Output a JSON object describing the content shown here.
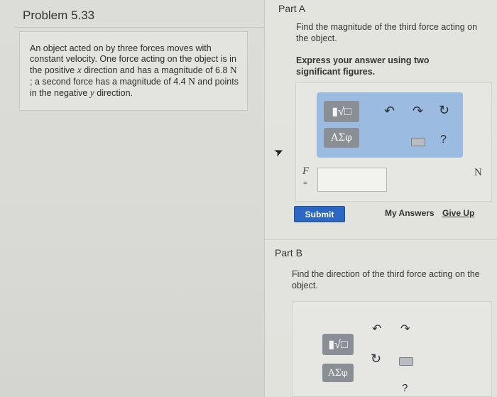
{
  "problem": {
    "title": "Problem 5.33",
    "text": {
      "p1": "An object acted on by three forces moves with constant velocity. One force acting on the object is in the positive ",
      "var_x": "x",
      "p2": " direction and has a magnitude of ",
      "val1": "6.8 ",
      "unit1": "N",
      "p3": " ; a second force has a magnitude of ",
      "val2": "4.4 ",
      "unit2": "N",
      "p4": " and points in the negative ",
      "var_y": "y",
      "p5": " direction."
    }
  },
  "part_a": {
    "label": "Part A",
    "question": "Find the magnitude of the third force acting on the object.",
    "instructions": "Express your answer using two significant figures.",
    "toolbar": {
      "templates_label": "▮√□",
      "symbols_label": "ΑΣφ",
      "undo_icon": "↶",
      "redo_icon": "↷",
      "reset_icon": "↻",
      "help_icon": "?"
    },
    "variable": "F",
    "equals": "=",
    "answer_value": "",
    "unit": "N",
    "submit_label": "Submit",
    "my_answers_label": "My Answers",
    "give_up_label": "Give Up"
  },
  "part_b": {
    "label": "Part B",
    "question": "Find the direction of the third force acting on the object.",
    "toolbar": {
      "templates_label": "▮√□",
      "symbols_label": "ΑΣφ",
      "undo_icon": "↶",
      "redo_icon": "↷",
      "reset_icon": "↻",
      "help_icon": "?"
    }
  },
  "colors": {
    "submit_blue": "#2b67c3",
    "toolbar_blue": "#9bbbe0"
  },
  "icons": {
    "cursor": "➤"
  }
}
